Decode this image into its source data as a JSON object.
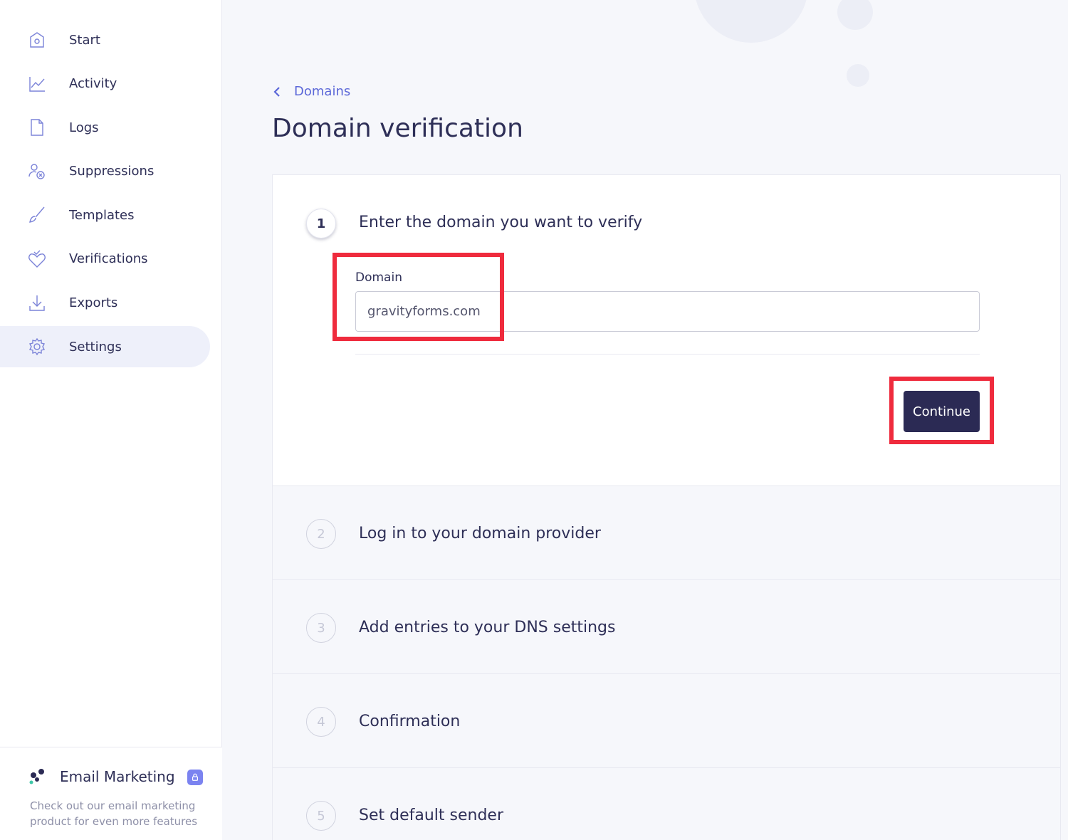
{
  "sidebar": {
    "items": [
      {
        "label": "Start",
        "icon": "home-icon",
        "active": false
      },
      {
        "label": "Activity",
        "icon": "chart-line-icon",
        "active": false
      },
      {
        "label": "Logs",
        "icon": "document-icon",
        "active": false
      },
      {
        "label": "Suppressions",
        "icon": "user-blocked-icon",
        "active": false
      },
      {
        "label": "Templates",
        "icon": "brush-icon",
        "active": false
      },
      {
        "label": "Verifications",
        "icon": "heart-check-icon",
        "active": false
      },
      {
        "label": "Exports",
        "icon": "download-icon",
        "active": false
      },
      {
        "label": "Settings",
        "icon": "gear-icon",
        "active": true
      }
    ],
    "promo": {
      "title": "Email Marketing",
      "description": "Check out our email marketing product for even more features",
      "icon": "lock-icon"
    }
  },
  "breadcrumb": {
    "label": "Domains",
    "icon": "chevron-left-icon"
  },
  "page_title": "Domain verification",
  "steps": [
    {
      "number": "1",
      "title": "Enter the domain you want to verify",
      "active": true
    },
    {
      "number": "2",
      "title": "Log in to your domain provider",
      "active": false
    },
    {
      "number": "3",
      "title": "Add entries to your DNS settings",
      "active": false
    },
    {
      "number": "4",
      "title": "Confirmation",
      "active": false
    },
    {
      "number": "5",
      "title": "Set default sender",
      "active": false
    }
  ],
  "form": {
    "domain_label": "Domain",
    "domain_value": "gravityforms.com",
    "continue_label": "Continue"
  },
  "colors": {
    "accent": "#5b67d8",
    "button": "#2b2a54",
    "highlight": "#ef2b3d",
    "text": "#2e2f57"
  }
}
